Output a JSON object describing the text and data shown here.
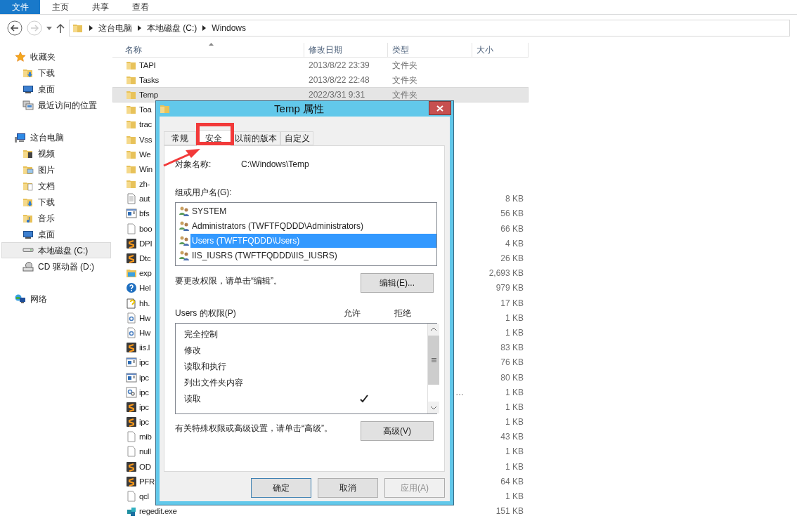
{
  "ribbon": {
    "tabs": [
      {
        "label": "文件",
        "selected": true
      },
      {
        "label": "主页",
        "selected": false
      },
      {
        "label": "共享",
        "selected": false
      },
      {
        "label": "查看",
        "selected": false
      }
    ]
  },
  "address": {
    "crumbs": [
      "这台电脑",
      "本地磁盘 (C:)",
      "Windows"
    ]
  },
  "sidebar": {
    "groups": [
      {
        "label": "收藏夹",
        "kind": "star",
        "items": [
          {
            "label": "下载",
            "kind": "download",
            "selected": false
          },
          {
            "label": "桌面",
            "kind": "desktop",
            "selected": false
          },
          {
            "label": "最近访问的位置",
            "kind": "recent",
            "selected": false
          }
        ]
      },
      {
        "label": "这台电脑",
        "kind": "pc",
        "items": [
          {
            "label": "视频",
            "kind": "video",
            "selected": false
          },
          {
            "label": "图片",
            "kind": "pictures",
            "selected": false
          },
          {
            "label": "文档",
            "kind": "documents",
            "selected": false
          },
          {
            "label": "下载",
            "kind": "download",
            "selected": false
          },
          {
            "label": "音乐",
            "kind": "music",
            "selected": false
          },
          {
            "label": "桌面",
            "kind": "desktop",
            "selected": false
          },
          {
            "label": "本地磁盘 (C:)",
            "kind": "drive",
            "selected": true
          },
          {
            "label": "CD 驱动器 (D:)",
            "kind": "cd",
            "selected": false
          }
        ]
      },
      {
        "label": "网络",
        "kind": "network"
      }
    ]
  },
  "files": {
    "columns": [
      "名称",
      "修改日期",
      "类型",
      "大小"
    ],
    "rows": [
      {
        "kind": "folder",
        "name": "TAPI",
        "date": "2013/8/22 23:39",
        "type": "文件夹",
        "selected": false
      },
      {
        "kind": "folder",
        "name": "Tasks",
        "date": "2013/8/22 22:48",
        "type": "文件夹",
        "selected": false
      },
      {
        "kind": "folder",
        "name": "Temp",
        "date": "2022/3/31 9:31",
        "type": "文件夹",
        "selected": true
      },
      {
        "kind": "folder",
        "name": "Toa",
        "selected": false
      },
      {
        "kind": "folder",
        "name": "trac",
        "selected": false
      },
      {
        "kind": "folder",
        "name": "Vss",
        "selected": false
      },
      {
        "kind": "folder",
        "name": "We",
        "selected": false
      },
      {
        "kind": "folder",
        "name": "Win",
        "selected": false
      },
      {
        "kind": "folder",
        "name": "zh-",
        "selected": false
      },
      {
        "kind": "text",
        "name": "aut",
        "size": "8 KB",
        "selected": false
      },
      {
        "kind": "window",
        "name": "bfs",
        "size": "56 KB",
        "selected": false
      },
      {
        "kind": "blank",
        "name": "boo",
        "size": "66 KB",
        "selected": false
      },
      {
        "kind": "sublime",
        "name": "DPI",
        "size": "4 KB",
        "selected": false
      },
      {
        "kind": "sublime",
        "name": "Dtc",
        "size": "26 KB",
        "selected": false
      },
      {
        "kind": "explorer",
        "name": "exp",
        "size": "2,693 KB",
        "selected": false
      },
      {
        "kind": "help",
        "name": "Hel",
        "size": "979 KB",
        "selected": false
      },
      {
        "kind": "hh",
        "name": "hh.",
        "size": "17 KB",
        "selected": false
      },
      {
        "kind": "config",
        "name": "Hw",
        "size": "1 KB",
        "selected": false
      },
      {
        "kind": "config",
        "name": "Hw",
        "size": "1 KB",
        "selected": false
      },
      {
        "kind": "sublime",
        "name": "iis.l",
        "size": "83 KB",
        "selected": false
      },
      {
        "kind": "window",
        "name": "ipc",
        "size": "76 KB",
        "selected": false
      },
      {
        "kind": "window",
        "name": "ipc",
        "size": "80 KB",
        "selected": false
      },
      {
        "kind": "gears",
        "name": "ipc",
        "type_tail": "…",
        "size": "1 KB",
        "selected": false
      },
      {
        "kind": "sublime",
        "name": "ipc",
        "size": "1 KB",
        "selected": false
      },
      {
        "kind": "sublime",
        "name": "ipc",
        "size": "1 KB",
        "selected": false
      },
      {
        "kind": "blank",
        "name": "mib",
        "size": "43 KB",
        "selected": false
      },
      {
        "kind": "blank",
        "name": "null",
        "size": "1 KB",
        "selected": false
      },
      {
        "kind": "sublime",
        "name": "OD",
        "size": "1 KB",
        "selected": false
      },
      {
        "kind": "sublime",
        "name": "PFR",
        "size": "64 KB",
        "selected": false
      },
      {
        "kind": "blank",
        "name": "qcl",
        "size": "1 KB",
        "selected": false
      },
      {
        "kind": "regedit",
        "name": "regedit.exe",
        "size": "151 KB",
        "selected": false
      }
    ]
  },
  "dialog": {
    "title": "Temp 属性",
    "tabs": [
      {
        "label": "常规",
        "selected": false
      },
      {
        "label": "安全",
        "selected": true
      },
      {
        "label": "以前的版本",
        "selected": false
      },
      {
        "label": "自定义",
        "selected": false
      }
    ],
    "object_label": "对象名称:",
    "object_value": "C:\\Windows\\Temp",
    "group_label": "组或用户名(G):",
    "principals": [
      {
        "name": "SYSTEM",
        "selected": false
      },
      {
        "name": "Administrators (TWFTFQDDD\\Administrators)",
        "selected": false
      },
      {
        "name": "Users (TWFTFQDDD\\Users)",
        "selected": true
      },
      {
        "name": "IIS_IUSRS (TWFTFQDDD\\IIS_IUSRS)",
        "selected": false
      }
    ],
    "edit_hint": "要更改权限，请单击“编辑”。",
    "edit_button": "编辑(E)...",
    "perm_label": "Users 的权限(P)",
    "allow_label": "允许",
    "deny_label": "拒绝",
    "permissions": [
      {
        "name": "完全控制",
        "allow": false,
        "deny": false
      },
      {
        "name": "修改",
        "allow": false,
        "deny": false
      },
      {
        "name": "读取和执行",
        "allow": false,
        "deny": false
      },
      {
        "name": "列出文件夹内容",
        "allow": false,
        "deny": false
      },
      {
        "name": "读取",
        "allow": true,
        "deny": false
      }
    ],
    "advanced_hint": "有关特殊权限或高级设置，请单击“高级”。",
    "advanced_button": "高级(V)",
    "buttons": [
      {
        "label": "确定",
        "kind": "default",
        "disabled": false
      },
      {
        "label": "取消",
        "kind": "normal",
        "disabled": false
      },
      {
        "label": "应用(A)",
        "kind": "normal",
        "disabled": true
      }
    ]
  }
}
